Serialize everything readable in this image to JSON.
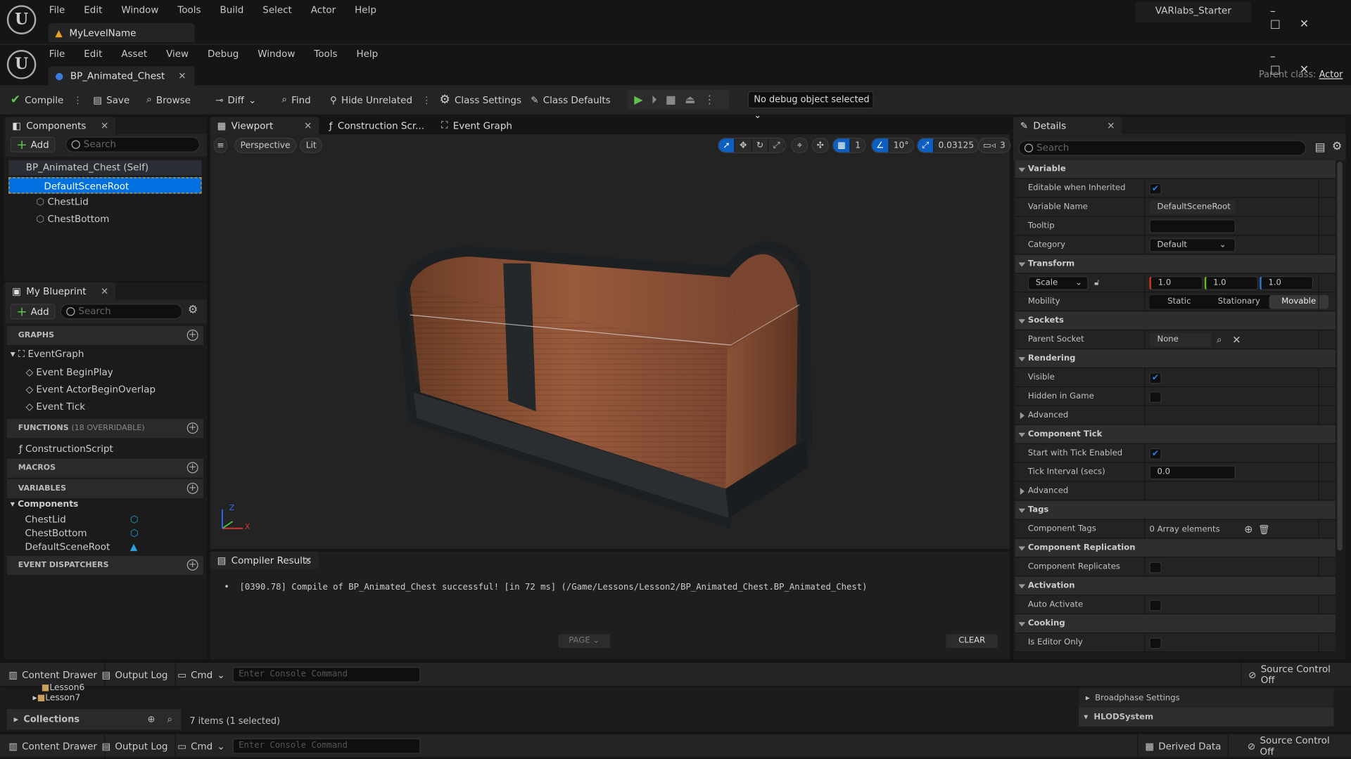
{
  "level_window": {
    "menu": [
      "File",
      "Edit",
      "Window",
      "Tools",
      "Build",
      "Select",
      "Actor",
      "Help"
    ],
    "level_tab": "MyLevelName",
    "project_name": "VARlabs_Starter"
  },
  "bp_window": {
    "menu": [
      "File",
      "Edit",
      "Asset",
      "View",
      "Debug",
      "Window",
      "Tools",
      "Help"
    ],
    "asset_tab": "BP_Animated_Chest",
    "parent_class_label": "Parent class:",
    "parent_class": "Actor"
  },
  "toolbar": {
    "compile": "Compile",
    "save": "Save",
    "browse": "Browse",
    "diff": "Diff",
    "find": "Find",
    "hide_unrelated": "Hide Unrelated",
    "class_settings": "Class Settings",
    "class_defaults": "Class Defaults",
    "debug_object": "No debug object selected"
  },
  "components": {
    "tab": "Components",
    "add": "Add",
    "search_placeholder": "Search",
    "self": "BP_Animated_Chest (Self)",
    "root": "DefaultSceneRoot",
    "children": [
      "ChestLid",
      "ChestBottom"
    ]
  },
  "my_blueprint": {
    "tab": "My Blueprint",
    "add": "Add",
    "search_placeholder": "Search",
    "graphs_label": "GRAPHS",
    "event_graph": "EventGraph",
    "events": [
      "Event BeginPlay",
      "Event ActorBeginOverlap",
      "Event Tick"
    ],
    "functions_label": "FUNCTIONS",
    "functions_note": "(18 OVERRIDABLE)",
    "functions": [
      "ConstructionScript"
    ],
    "macros_label": "MACROS",
    "variables_label": "VARIABLES",
    "var_category": "Components",
    "variables": [
      "ChestLid",
      "ChestBottom",
      "DefaultSceneRoot"
    ],
    "dispatchers_label": "EVENT DISPATCHERS"
  },
  "editor_tabs": {
    "viewport": "Viewport",
    "construction": "Construction Scr...",
    "event_graph": "Event Graph"
  },
  "viewport": {
    "perspective": "Perspective",
    "lit": "Lit",
    "grid_snap": "1",
    "rotation_snap": "10°",
    "scale_snap": "0.03125",
    "camera_speed": "3",
    "axis_x": "X",
    "axis_z": "Z"
  },
  "compiler": {
    "tab": "Compiler Results",
    "message": "[0390.78] Compile of BP_Animated_Chest successful! [in 72 ms] (/Game/Lessons/Lesson2/BP_Animated_Chest.BP_Animated_Chest)",
    "page": "PAGE",
    "clear": "CLEAR"
  },
  "details": {
    "tab": "Details",
    "search_placeholder": "Search",
    "rows": [
      {
        "type": "header",
        "label": "Variable"
      },
      {
        "type": "check",
        "label": "Editable when Inherited",
        "checked": true
      },
      {
        "type": "text",
        "label": "Variable Name",
        "value": "DefaultSceneRoot"
      },
      {
        "type": "text",
        "label": "Tooltip",
        "value": ""
      },
      {
        "type": "combo",
        "label": "Category",
        "value": "Default"
      },
      {
        "type": "header",
        "label": "Transform"
      },
      {
        "type": "vec3",
        "label": "Scale",
        "value": [
          "1.0",
          "1.0",
          "1.0"
        ]
      },
      {
        "type": "mobility",
        "label": "Mobility",
        "options": [
          "Static",
          "Stationary",
          "Movable"
        ],
        "selected": "Movable"
      },
      {
        "type": "header",
        "label": "Sockets"
      },
      {
        "type": "socket",
        "label": "Parent Socket",
        "value": "None"
      },
      {
        "type": "header",
        "label": "Rendering"
      },
      {
        "type": "check",
        "label": "Visible",
        "checked": true
      },
      {
        "type": "check",
        "label": "Hidden in Game",
        "checked": false
      },
      {
        "type": "expander",
        "label": "Advanced"
      },
      {
        "type": "header",
        "label": "Component Tick"
      },
      {
        "type": "check",
        "label": "Start with Tick Enabled",
        "checked": true
      },
      {
        "type": "text",
        "label": "Tick Interval (secs)",
        "value": "0.0"
      },
      {
        "type": "expander",
        "label": "Advanced"
      },
      {
        "type": "header",
        "label": "Tags"
      },
      {
        "type": "tags",
        "label": "Component Tags",
        "value": "0 Array elements"
      },
      {
        "type": "header",
        "label": "Component Replication"
      },
      {
        "type": "check",
        "label": "Component Replicates",
        "checked": false
      },
      {
        "type": "header",
        "label": "Activation"
      },
      {
        "type": "check",
        "label": "Auto Activate",
        "checked": false
      },
      {
        "type": "header",
        "label": "Cooking"
      },
      {
        "type": "check",
        "label": "Is Editor Only",
        "checked": false
      }
    ]
  },
  "bottom_bar": {
    "content_drawer": "Content Drawer",
    "output_log": "Output Log",
    "cmd": "Cmd",
    "console_placeholder": "Enter Console Command",
    "source_control": "Source Control Off",
    "derived_data": "Derived Data"
  },
  "content_browser": {
    "folders": [
      "Lesson6",
      "Lesson7"
    ],
    "collections": "Collections",
    "items_count": "7 items (1 selected)"
  },
  "world_settings": {
    "broadphase": "Broadphase Settings",
    "hlod": "HLODSystem"
  },
  "colors": {
    "accent": "#0e5fc2",
    "selection": "#0070e0",
    "play_green": "#5fc24f",
    "checkbox": "#2a7de1"
  }
}
